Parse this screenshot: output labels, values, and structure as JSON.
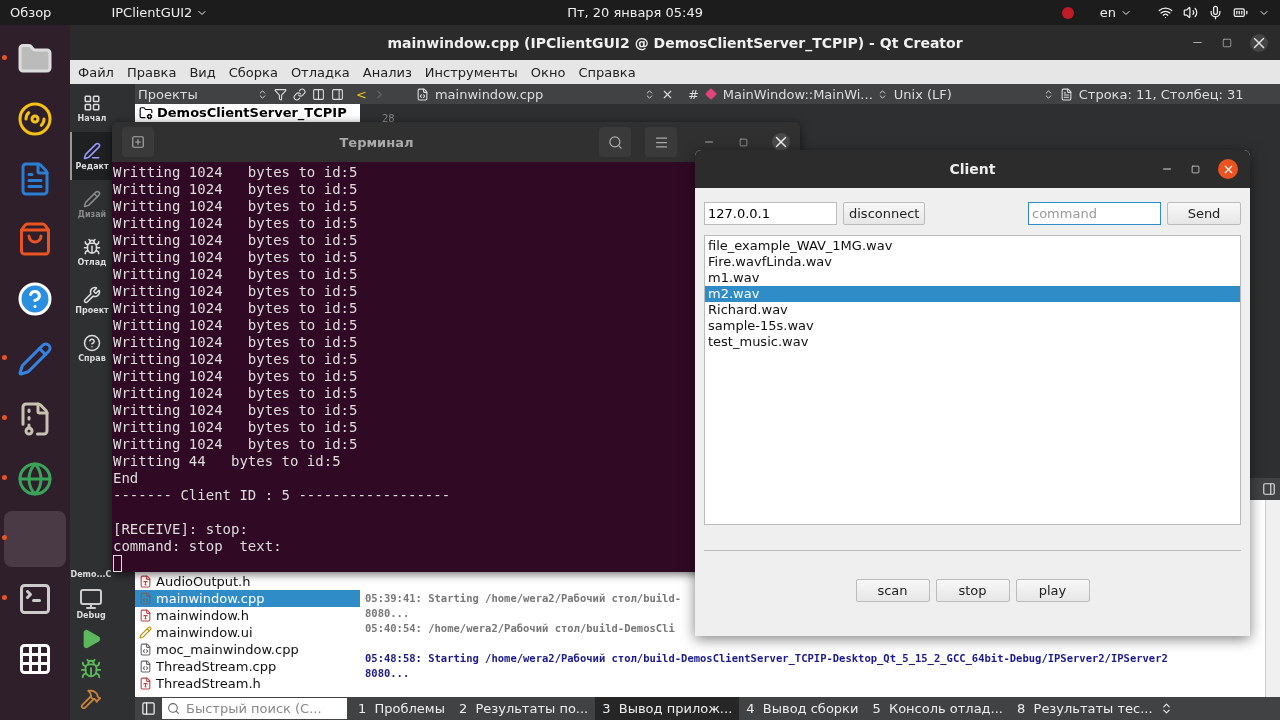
{
  "top_bar": {
    "activities": "Обзор",
    "app_menu": "IPClientGUI2",
    "clock": "Пт, 20 января  05:49",
    "language": "en"
  },
  "dock": {
    "items": [
      {
        "kind": "files",
        "selected": false,
        "running": true
      },
      {
        "kind": "music",
        "selected": false,
        "running": false
      },
      {
        "kind": "writer",
        "selected": false,
        "running": false
      },
      {
        "kind": "store",
        "selected": false,
        "running": false
      },
      {
        "kind": "help",
        "selected": false,
        "running": false
      },
      {
        "kind": "editor",
        "selected": false,
        "running": true
      },
      {
        "kind": "archive",
        "selected": false,
        "running": true
      },
      {
        "kind": "globe",
        "selected": false,
        "running": true
      },
      {
        "kind": "blank",
        "selected": true,
        "running": true
      },
      {
        "kind": "terminal",
        "selected": false,
        "running": true
      },
      {
        "kind": "apps",
        "selected": false,
        "running": false
      }
    ]
  },
  "qt_window": {
    "title": "mainwindow.cpp (IPClientGUI2 @ DemosClientServer_TCPIP) - Qt Creator",
    "menu": [
      "Файл",
      "Правка",
      "Вид",
      "Сборка",
      "Отладка",
      "Анализ",
      "Инструменты",
      "Окно",
      "Справка"
    ],
    "toolbar": {
      "view_combo": "Проекты",
      "back": "<",
      "file_tab": "mainwindow.cpp",
      "hash": "#",
      "symbol": "MainWindow::MainWi...",
      "line_ending": "Unix (LF)",
      "cursor": "Строка: 11, Столбец: 31"
    },
    "modes": [
      {
        "kind": "welcome",
        "label": "Начал",
        "selected": false,
        "disabled": false
      },
      {
        "kind": "edit",
        "label": "Редакт",
        "selected": true,
        "disabled": false
      },
      {
        "kind": "design",
        "label": "Дизай",
        "selected": false,
        "disabled": true
      },
      {
        "kind": "debug",
        "label": "Отлад",
        "selected": false,
        "disabled": false
      },
      {
        "kind": "projects",
        "label": "Проект",
        "selected": false,
        "disabled": false
      },
      {
        "kind": "help",
        "label": "Справ",
        "selected": false,
        "disabled": false
      }
    ],
    "kit": {
      "project": "Demo...C",
      "config": "Debug"
    },
    "project_root": "DemosClientServer_TCPIP",
    "files": [
      {
        "name": "AudioOutput.h",
        "kind": "header",
        "selected": false
      },
      {
        "name": "mainwindow.cpp",
        "kind": "source",
        "selected": true
      },
      {
        "name": "mainwindow.h",
        "kind": "header",
        "selected": false
      },
      {
        "name": "mainwindow.ui",
        "kind": "form",
        "selected": false
      },
      {
        "name": "moc_mainwindow.cpp",
        "kind": "source",
        "selected": false
      },
      {
        "name": "ThreadStream.cpp",
        "kind": "source",
        "selected": false
      },
      {
        "name": "ThreadStream.h",
        "kind": "header",
        "selected": false
      }
    ],
    "line_number": "28",
    "output": [
      {
        "text": "05:39:41: Starting /home/wera2/Рабочий стол/build-",
        "kind": "plain"
      },
      {
        "text": "8080...",
        "kind": "plain"
      },
      {
        "text": "05:40:54: /home/wera2/Рабочий стол/build-DemosCli",
        "kind": "plain"
      },
      {
        "text": "05:48:58: Starting /home/wera2/Рабочий стол/build-DemosClientServer_TCPIP-Desktop_Qt_5_15_2_GCC_64bit-Debug/IPServer2/IPServer2",
        "kind": "start"
      },
      {
        "text": "8080...",
        "kind": "start"
      }
    ],
    "search": {
      "placeholder": "Быстрый поиск (С..."
    },
    "panes": [
      {
        "label": "1  Проблемы",
        "selected": false
      },
      {
        "label": "2  Результаты по...",
        "selected": false
      },
      {
        "label": "3  Вывод прилож...",
        "selected": true
      },
      {
        "label": "4  Вывод сборки",
        "selected": false
      },
      {
        "label": "5  Консоль отлад...",
        "selected": false
      },
      {
        "label": "8  Результаты тес...",
        "selected": false
      }
    ]
  },
  "terminal": {
    "title": "Терминал",
    "lines": [
      "Writting 1024   bytes to id:5",
      "Writting 1024   bytes to id:5",
      "Writting 1024   bytes to id:5",
      "Writting 1024   bytes to id:5",
      "Writting 1024   bytes to id:5",
      "Writting 1024   bytes to id:5",
      "Writting 1024   bytes to id:5",
      "Writting 1024   bytes to id:5",
      "Writting 1024   bytes to id:5",
      "Writting 1024   bytes to id:5",
      "Writting 1024   bytes to id:5",
      "Writting 1024   bytes to id:5",
      "Writting 1024   bytes to id:5",
      "Writting 1024   bytes to id:5",
      "Writting 1024   bytes to id:5",
      "Writting 1024   bytes to id:5",
      "Writting 1024   bytes to id:5",
      "Writting 44   bytes to id:5",
      "End",
      "------- Client ID : 5 ------------------"
    ],
    "prompt_lines": [
      "[RECEIVE]: stop:",
      "command: stop  text:"
    ]
  },
  "client": {
    "title": "Client",
    "address": "127.0.0.1",
    "connect_button": "disconnect",
    "command": {
      "placeholder": "command"
    },
    "send_button": "Send",
    "files": [
      {
        "name": "file_example_WAV_1MG.wav",
        "selected": false
      },
      {
        "name": "Fire.wavfLinda.wav",
        "selected": false
      },
      {
        "name": "m1.wav",
        "selected": false
      },
      {
        "name": "m2.wav",
        "selected": true
      },
      {
        "name": "Richard.wav",
        "selected": false
      },
      {
        "name": "sample-15s.wav",
        "selected": false
      },
      {
        "name": "test_music.wav",
        "selected": false
      }
    ],
    "buttons": [
      "scan",
      "stop",
      "play"
    ]
  }
}
